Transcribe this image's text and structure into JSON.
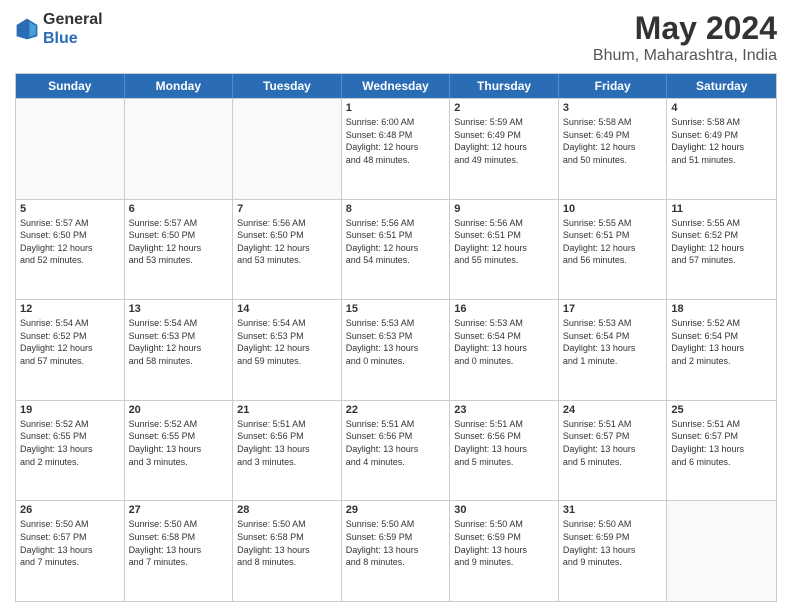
{
  "logo": {
    "line1": "General",
    "line2": "Blue"
  },
  "title": "May 2024",
  "location": "Bhum, Maharashtra, India",
  "weekdays": [
    "Sunday",
    "Monday",
    "Tuesday",
    "Wednesday",
    "Thursday",
    "Friday",
    "Saturday"
  ],
  "rows": [
    [
      {
        "day": "",
        "text": "",
        "empty": true
      },
      {
        "day": "",
        "text": "",
        "empty": true
      },
      {
        "day": "",
        "text": "",
        "empty": true
      },
      {
        "day": "1",
        "text": "Sunrise: 6:00 AM\nSunset: 6:48 PM\nDaylight: 12 hours\nand 48 minutes."
      },
      {
        "day": "2",
        "text": "Sunrise: 5:59 AM\nSunset: 6:49 PM\nDaylight: 12 hours\nand 49 minutes."
      },
      {
        "day": "3",
        "text": "Sunrise: 5:58 AM\nSunset: 6:49 PM\nDaylight: 12 hours\nand 50 minutes."
      },
      {
        "day": "4",
        "text": "Sunrise: 5:58 AM\nSunset: 6:49 PM\nDaylight: 12 hours\nand 51 minutes."
      }
    ],
    [
      {
        "day": "5",
        "text": "Sunrise: 5:57 AM\nSunset: 6:50 PM\nDaylight: 12 hours\nand 52 minutes."
      },
      {
        "day": "6",
        "text": "Sunrise: 5:57 AM\nSunset: 6:50 PM\nDaylight: 12 hours\nand 53 minutes."
      },
      {
        "day": "7",
        "text": "Sunrise: 5:56 AM\nSunset: 6:50 PM\nDaylight: 12 hours\nand 53 minutes."
      },
      {
        "day": "8",
        "text": "Sunrise: 5:56 AM\nSunset: 6:51 PM\nDaylight: 12 hours\nand 54 minutes."
      },
      {
        "day": "9",
        "text": "Sunrise: 5:56 AM\nSunset: 6:51 PM\nDaylight: 12 hours\nand 55 minutes."
      },
      {
        "day": "10",
        "text": "Sunrise: 5:55 AM\nSunset: 6:51 PM\nDaylight: 12 hours\nand 56 minutes."
      },
      {
        "day": "11",
        "text": "Sunrise: 5:55 AM\nSunset: 6:52 PM\nDaylight: 12 hours\nand 57 minutes."
      }
    ],
    [
      {
        "day": "12",
        "text": "Sunrise: 5:54 AM\nSunset: 6:52 PM\nDaylight: 12 hours\nand 57 minutes."
      },
      {
        "day": "13",
        "text": "Sunrise: 5:54 AM\nSunset: 6:53 PM\nDaylight: 12 hours\nand 58 minutes."
      },
      {
        "day": "14",
        "text": "Sunrise: 5:54 AM\nSunset: 6:53 PM\nDaylight: 12 hours\nand 59 minutes."
      },
      {
        "day": "15",
        "text": "Sunrise: 5:53 AM\nSunset: 6:53 PM\nDaylight: 13 hours\nand 0 minutes."
      },
      {
        "day": "16",
        "text": "Sunrise: 5:53 AM\nSunset: 6:54 PM\nDaylight: 13 hours\nand 0 minutes."
      },
      {
        "day": "17",
        "text": "Sunrise: 5:53 AM\nSunset: 6:54 PM\nDaylight: 13 hours\nand 1 minute."
      },
      {
        "day": "18",
        "text": "Sunrise: 5:52 AM\nSunset: 6:54 PM\nDaylight: 13 hours\nand 2 minutes."
      }
    ],
    [
      {
        "day": "19",
        "text": "Sunrise: 5:52 AM\nSunset: 6:55 PM\nDaylight: 13 hours\nand 2 minutes."
      },
      {
        "day": "20",
        "text": "Sunrise: 5:52 AM\nSunset: 6:55 PM\nDaylight: 13 hours\nand 3 minutes."
      },
      {
        "day": "21",
        "text": "Sunrise: 5:51 AM\nSunset: 6:56 PM\nDaylight: 13 hours\nand 3 minutes."
      },
      {
        "day": "22",
        "text": "Sunrise: 5:51 AM\nSunset: 6:56 PM\nDaylight: 13 hours\nand 4 minutes."
      },
      {
        "day": "23",
        "text": "Sunrise: 5:51 AM\nSunset: 6:56 PM\nDaylight: 13 hours\nand 5 minutes."
      },
      {
        "day": "24",
        "text": "Sunrise: 5:51 AM\nSunset: 6:57 PM\nDaylight: 13 hours\nand 5 minutes."
      },
      {
        "day": "25",
        "text": "Sunrise: 5:51 AM\nSunset: 6:57 PM\nDaylight: 13 hours\nand 6 minutes."
      }
    ],
    [
      {
        "day": "26",
        "text": "Sunrise: 5:50 AM\nSunset: 6:57 PM\nDaylight: 13 hours\nand 7 minutes."
      },
      {
        "day": "27",
        "text": "Sunrise: 5:50 AM\nSunset: 6:58 PM\nDaylight: 13 hours\nand 7 minutes."
      },
      {
        "day": "28",
        "text": "Sunrise: 5:50 AM\nSunset: 6:58 PM\nDaylight: 13 hours\nand 8 minutes."
      },
      {
        "day": "29",
        "text": "Sunrise: 5:50 AM\nSunset: 6:59 PM\nDaylight: 13 hours\nand 8 minutes."
      },
      {
        "day": "30",
        "text": "Sunrise: 5:50 AM\nSunset: 6:59 PM\nDaylight: 13 hours\nand 9 minutes."
      },
      {
        "day": "31",
        "text": "Sunrise: 5:50 AM\nSunset: 6:59 PM\nDaylight: 13 hours\nand 9 minutes."
      },
      {
        "day": "",
        "text": "",
        "empty": true
      }
    ]
  ]
}
